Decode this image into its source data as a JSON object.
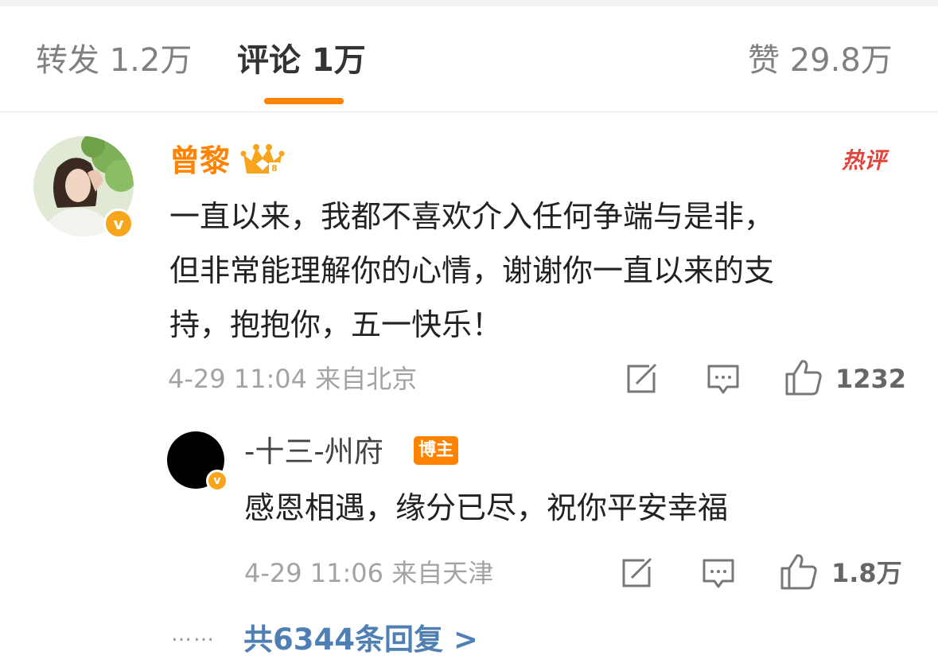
{
  "colors": {
    "accent_orange": "#ff8200",
    "vip_orange": "#f7a51c",
    "hot_red": "#e0463e",
    "link_blue": "#4f7fb3",
    "bozhu_orange": "#ff8200"
  },
  "tabs": {
    "repost": "转发 1.2万",
    "comment": "评论 1万",
    "like": "赞 29.8万"
  },
  "comment": {
    "user": "曾黎",
    "badge_icon": "vip-crown-icon",
    "hot_label": "热评",
    "lines": [
      "一直以来，我都不喜欢介入任何争端与是非，",
      "但非常能理解你的心情，谢谢你一直以来的支",
      "持，抱抱你，五一快乐！"
    ],
    "meta": "4-29 11:04 来自北京",
    "likes": "1232"
  },
  "reply": {
    "user": "-十三-州府",
    "tag": "博主",
    "text": "感恩相遇，缘分已尽，祝你平安幸福",
    "meta": "4-29 11:06 来自天津",
    "likes": "1.8万"
  },
  "more": {
    "dots": "……",
    "link": "共6344条回复 >"
  }
}
